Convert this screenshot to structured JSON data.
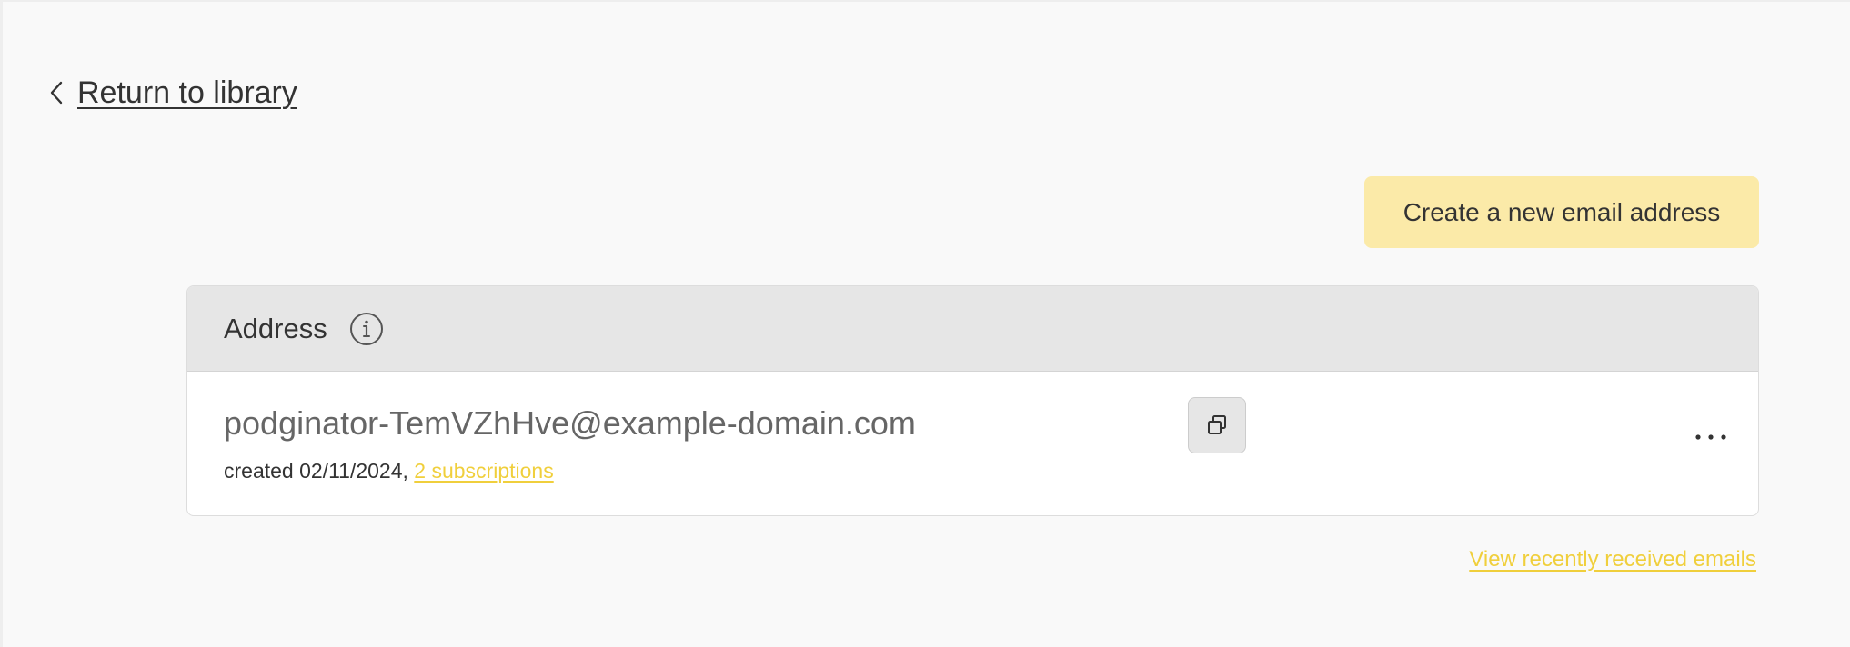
{
  "nav": {
    "return_label": "Return to library"
  },
  "actions": {
    "create_label": "Create a new email address",
    "view_recent_label": "View recently received emails"
  },
  "address_table": {
    "header": "Address",
    "rows": [
      {
        "email": "podginator-TemVZhHve@example-domain.com",
        "created": "created 02/11/2024,",
        "subscriptions": "2 subscriptions"
      }
    ]
  },
  "icons": {
    "back": "chevron-left-icon",
    "info": "info-icon",
    "copy": "copy-icon",
    "more": "more-horizontal-icon"
  },
  "colors": {
    "background": "#f9f9f9",
    "accent_button": "#fbeaa8",
    "link_accent": "#f0cf3c",
    "header_bg": "#e6e6e6",
    "text": "#333333",
    "email_text": "#666666"
  }
}
